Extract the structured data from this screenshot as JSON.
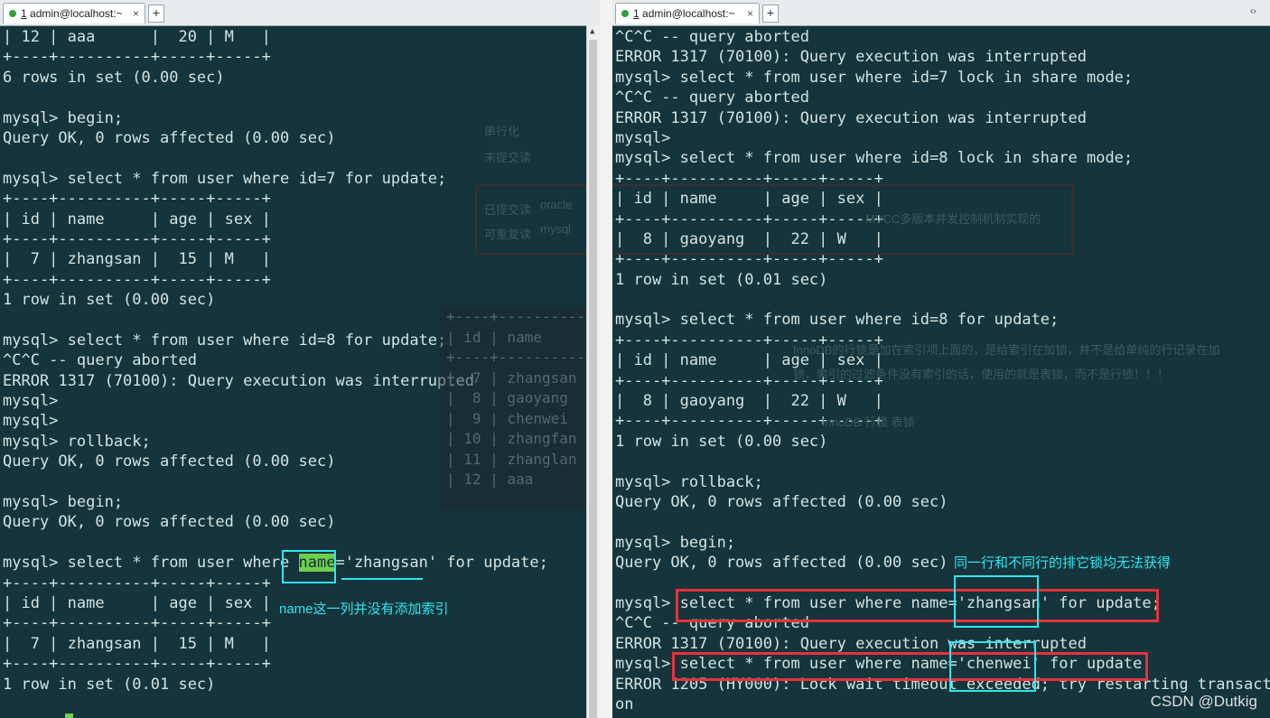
{
  "left": {
    "tab_title_num": "1",
    "tab_title": " admin@localhost:~",
    "lines": [
      "| 12 | aaa      |  20 | M   |",
      "+----+----------+-----+-----+",
      "6 rows in set (0.00 sec)",
      "",
      "mysql> begin;",
      "Query OK, 0 rows affected (0.00 sec)",
      "",
      "mysql> select * from user where id=7 for update;",
      "+----+----------+-----+-----+",
      "| id | name     | age | sex |",
      "+----+----------+-----+-----+",
      "|  7 | zhangsan |  15 | M   |",
      "+----+----------+-----+-----+",
      "1 row in set (0.00 sec)",
      "",
      "mysql> select * from user where id=8 for update;",
      "^C^C -- query aborted",
      "ERROR 1317 (70100): Query execution was interrupted",
      "mysql>",
      "mysql>",
      "mysql> rollback;",
      "Query OK, 0 rows affected (0.00 sec)",
      "",
      "mysql> begin;",
      "Query OK, 0 rows affected (0.00 sec)",
      "",
      "mysql> select * from user where |name|='zhangsan' for update;",
      "+----+----------+-----+-----+",
      "| id | name     | age | sex |",
      "+----+----------+-----+-----+",
      "|  7 | zhangsan |  15 | M   |",
      "+----+----------+-----+-----+",
      "1 row in set (0.01 sec)"
    ],
    "annotation": "name这一列并没有添加索引"
  },
  "right": {
    "tab_title_num": "1",
    "tab_title": " admin@localhost:~",
    "lines": [
      "^C^C -- query aborted",
      "ERROR 1317 (70100): Query execution was interrupted",
      "mysql> select * from user where id=7 lock in share mode;",
      "^C^C -- query aborted",
      "ERROR 1317 (70100): Query execution was interrupted",
      "mysql>",
      "mysql> select * from user where id=8 lock in share mode;",
      "+----+----------+-----+-----+",
      "| id | name     | age | sex |",
      "+----+----------+-----+-----+",
      "|  8 | gaoyang  |  22 | W   |",
      "+----+----------+-----+-----+",
      "1 row in set (0.01 sec)",
      "",
      "mysql> select * from user where id=8 for update;",
      "+----+----------+-----+-----+",
      "| id | name     | age | sex |",
      "+----+----------+-----+-----+",
      "|  8 | gaoyang  |  22 | W   |",
      "+----+----------+-----+-----+",
      "1 row in set (0.00 sec)",
      "",
      "mysql> rollback;",
      "Query OK, 0 rows affected (0.00 sec)",
      "",
      "mysql> begin;",
      "Query OK, 0 rows affected (0.00 sec)",
      "",
      "mysql> select * from user where name='zhangsan' for update;",
      "^C^C -- query aborted",
      "ERROR 1317 (70100): Query execution was interrupted",
      "mysql> select * from user where name='chenwei' for update;",
      "ERROR 1205 (HY000): Lock wait timeout exceeded; try restarting transacti",
      "on"
    ],
    "annotation": "同一行和不同行的排它锁均无法获得"
  },
  "background_notes": {
    "isolation_1": "串行化",
    "isolation_2": "未提交读",
    "isolation_3": "已提交读",
    "isolation_4": "可重复读",
    "oracle": "oracle",
    "mysql": "mysql",
    "mvcc": "MVCC多版本并发控制机制实现的",
    "innodb_note_1": "InnoDB的行锁是加在索引项上面的，是给索引在加锁，并不是给单纯的行记录在加",
    "innodb_note_2": "锁，索引的过滤条件没有索引的话，使用的就是表锁，而不是行锁！！！",
    "innodb_note_3": "InnoDB    行锁    表锁"
  },
  "ghost_table": [
    "+----+----------+",
    "| id | name     |",
    "+----+----------+",
    "|  7 | zhangsan |",
    "|  8 | gaoyang  |",
    "|  9 | chenwei  |",
    "| 10 | zhangfan |",
    "| 11 | zhanglan |",
    "| 12 | aaa      |"
  ],
  "watermark": "CSDN @Dutkig",
  "colors": {
    "terminal_bg": "#15343b",
    "terminal_fg": "#d4e4e2",
    "highlight": "#6cd04a",
    "cyan_note": "#2ee6f0",
    "red_box": "#e8313a"
  }
}
